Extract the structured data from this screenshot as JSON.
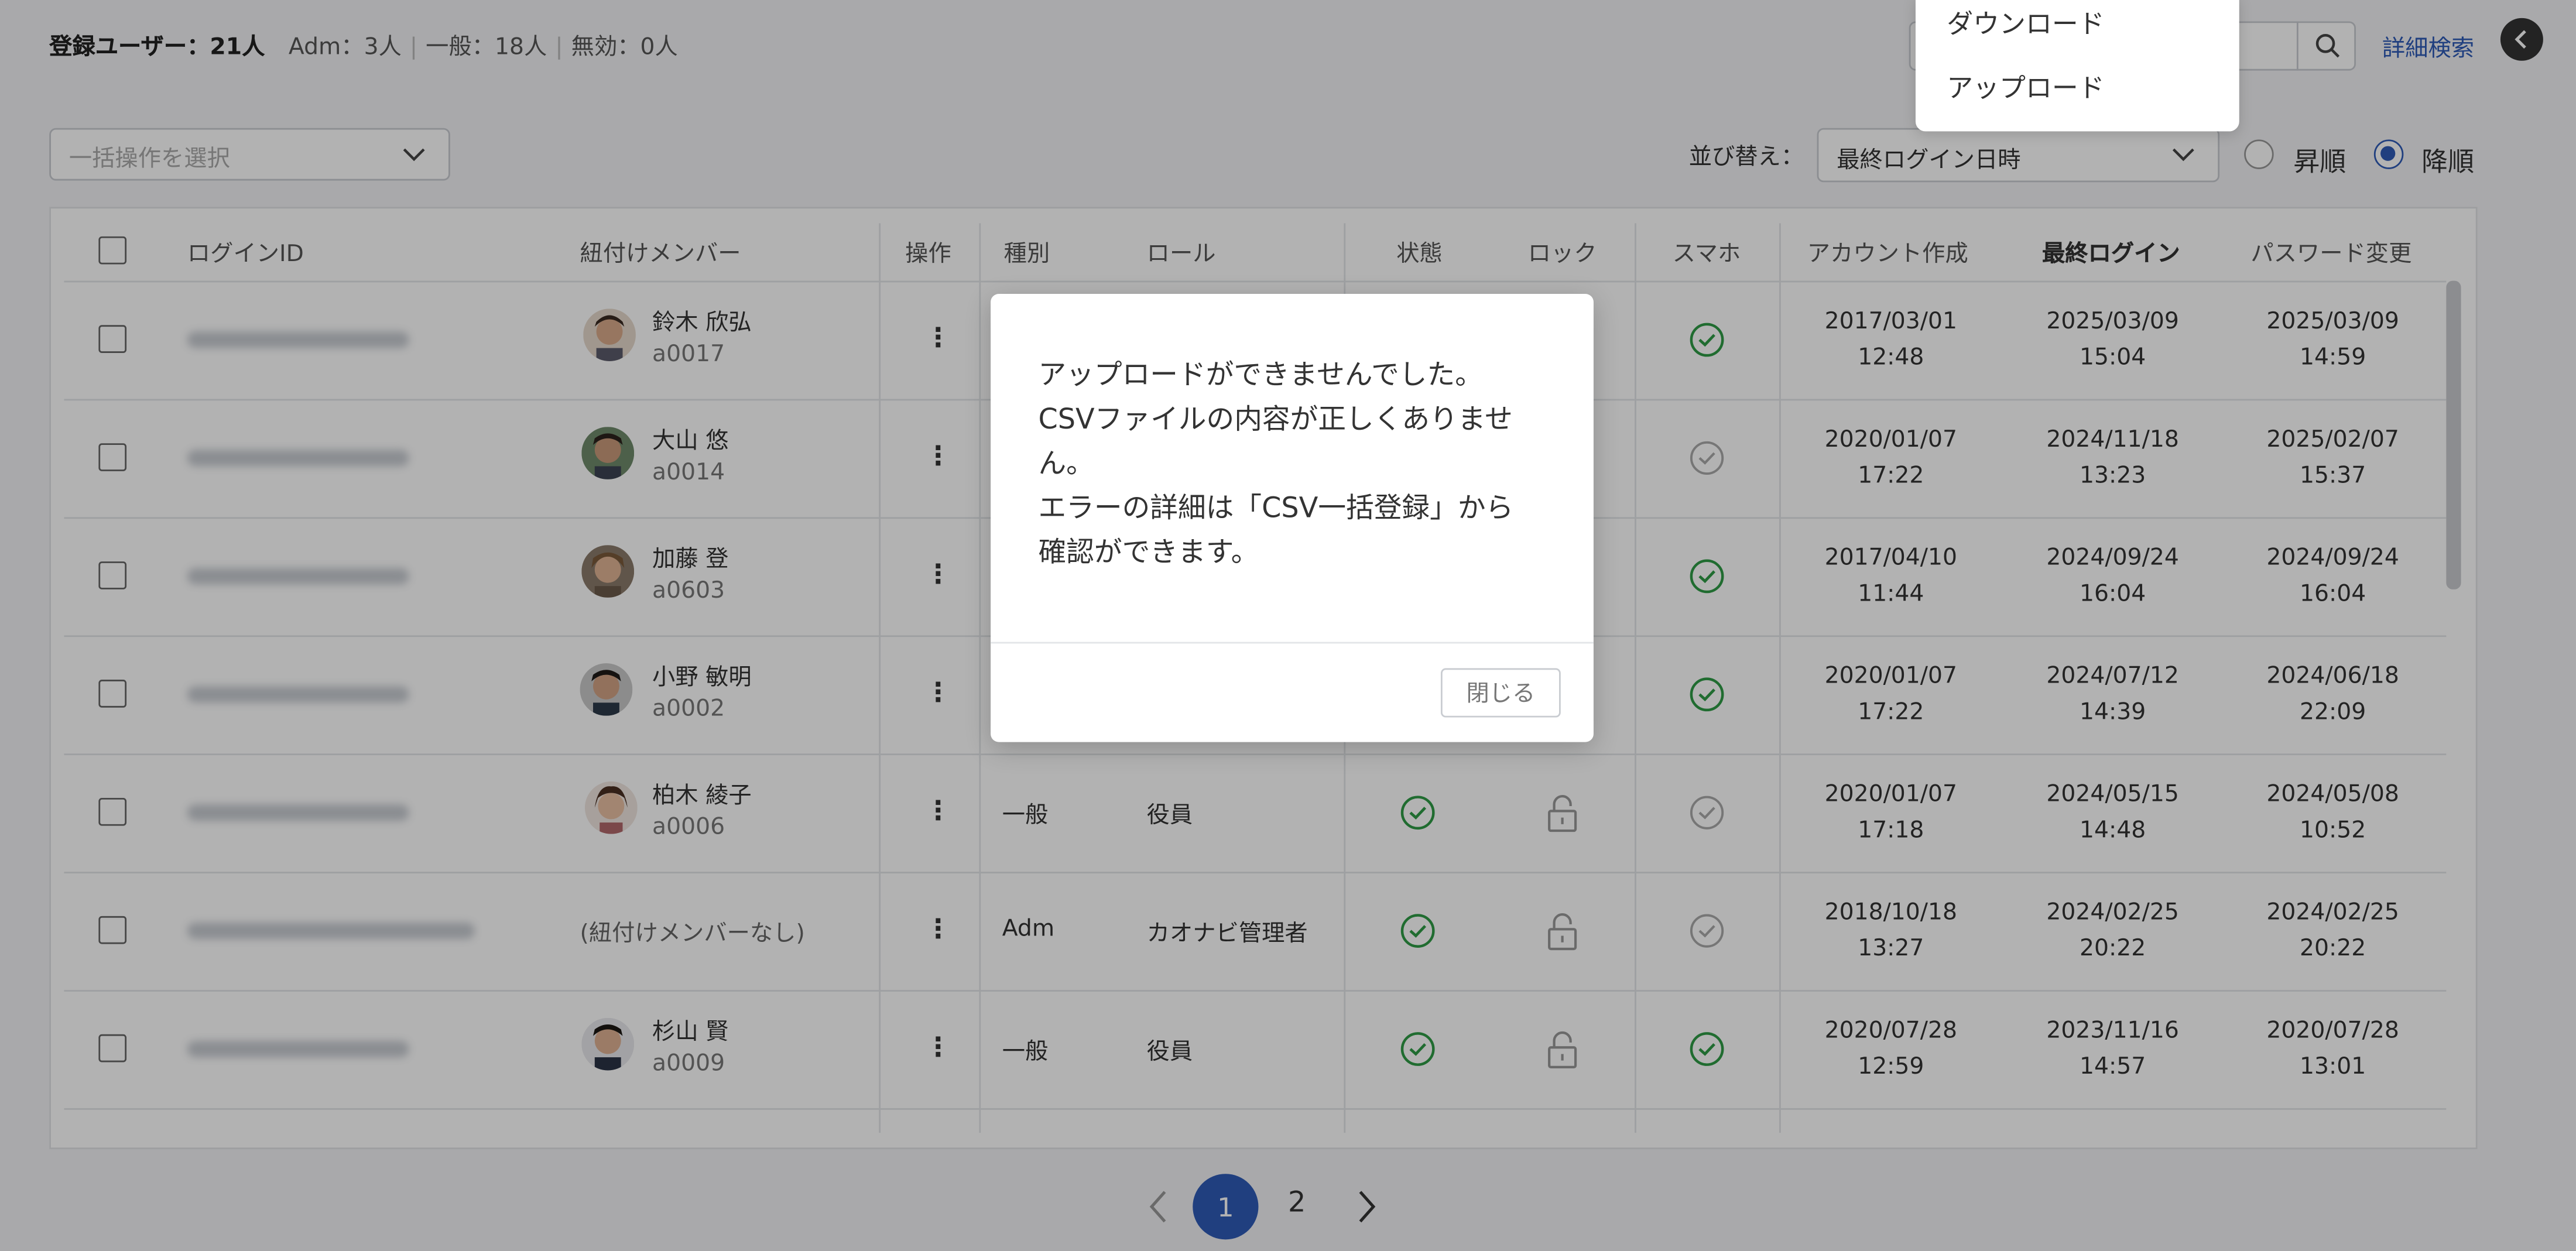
{
  "summary": {
    "label": "登録ユーザー：21人",
    "adm": "Adm：3人",
    "general": "一般：18人",
    "disabled": "無効：0人"
  },
  "header": {
    "advanced_search": "詳細検索"
  },
  "dropdown_menu": {
    "items": [
      "ダウンロード",
      "アップロード"
    ]
  },
  "toolbar": {
    "bulk_placeholder": "一括操作を選択",
    "sort_label": "並び替え：",
    "sort_value": "最終ログイン日時",
    "asc_label": "昇順",
    "desc_label": "降順",
    "selected_order": "降順"
  },
  "table": {
    "headers": {
      "login_id": "ログインID",
      "member": "紐付けメンバー",
      "action": "操作",
      "type": "種別",
      "role": "ロール",
      "status": "状態",
      "lock": "ロック",
      "smartphone": "スマホ",
      "created": "アカウント作成",
      "last_login": "最終ログイン",
      "password_changed": "パスワード変更"
    },
    "rows": [
      {
        "member_name": "鈴木 欣弘",
        "member_code": "a0017",
        "no_member": "",
        "type": "",
        "role": "",
        "smartphone": "active",
        "created": [
          "2017/03/01",
          "12:48"
        ],
        "last_login": [
          "2025/03/09",
          "15:04"
        ],
        "password": [
          "2025/03/09",
          "14:59"
        ]
      },
      {
        "member_name": "大山 悠",
        "member_code": "a0014",
        "no_member": "",
        "type": "",
        "role": "",
        "smartphone": "inactive",
        "created": [
          "2020/01/07",
          "17:22"
        ],
        "last_login": [
          "2024/11/18",
          "13:23"
        ],
        "password": [
          "2025/02/07",
          "15:37"
        ]
      },
      {
        "member_name": "加藤 登",
        "member_code": "a0603",
        "no_member": "",
        "type": "",
        "role": "",
        "smartphone": "active",
        "created": [
          "2017/04/10",
          "11:44"
        ],
        "last_login": [
          "2024/09/24",
          "16:04"
        ],
        "password": [
          "2024/09/24",
          "16:04"
        ]
      },
      {
        "member_name": "小野 敏明",
        "member_code": "a0002",
        "no_member": "",
        "type": "",
        "role": "",
        "smartphone": "active",
        "created": [
          "2020/01/07",
          "17:22"
        ],
        "last_login": [
          "2024/07/12",
          "14:39"
        ],
        "password": [
          "2024/06/18",
          "22:09"
        ]
      },
      {
        "member_name": "柏木 綾子",
        "member_code": "a0006",
        "no_member": "",
        "type": "一般",
        "role": "役員",
        "smartphone": "inactive",
        "created": [
          "2020/01/07",
          "17:18"
        ],
        "last_login": [
          "2024/05/15",
          "14:48"
        ],
        "password": [
          "2024/05/08",
          "10:52"
        ]
      },
      {
        "member_name": "",
        "member_code": "",
        "no_member": "(紐付けメンバーなし)",
        "type": "Adm",
        "role": "カオナビ管理者",
        "smartphone": "inactive",
        "created": [
          "2018/10/18",
          "13:27"
        ],
        "last_login": [
          "2024/02/25",
          "20:22"
        ],
        "password": [
          "2024/02/25",
          "20:22"
        ]
      },
      {
        "member_name": "杉山 賢",
        "member_code": "a0009",
        "no_member": "",
        "type": "一般",
        "role": "役員",
        "smartphone": "active",
        "created": [
          "2020/07/28",
          "12:59"
        ],
        "last_login": [
          "2023/11/16",
          "14:57"
        ],
        "password": [
          "2020/07/28",
          "13:01"
        ]
      }
    ]
  },
  "pagination": {
    "current": "1",
    "next_page": "2"
  },
  "modal": {
    "lines": [
      "アップロードができませんでした。",
      "CSVファイルの内容が正しくありませ",
      "ん。",
      "エラーの詳細は「CSV一括登録」から",
      "確認ができます。"
    ],
    "close_label": "閉じる"
  },
  "colors": {
    "accent": "#2f5bb7",
    "status_green": "#2e9b45",
    "inactive_grey": "#aaaaaa",
    "overlay": "rgba(0,0,0,0.30)"
  }
}
